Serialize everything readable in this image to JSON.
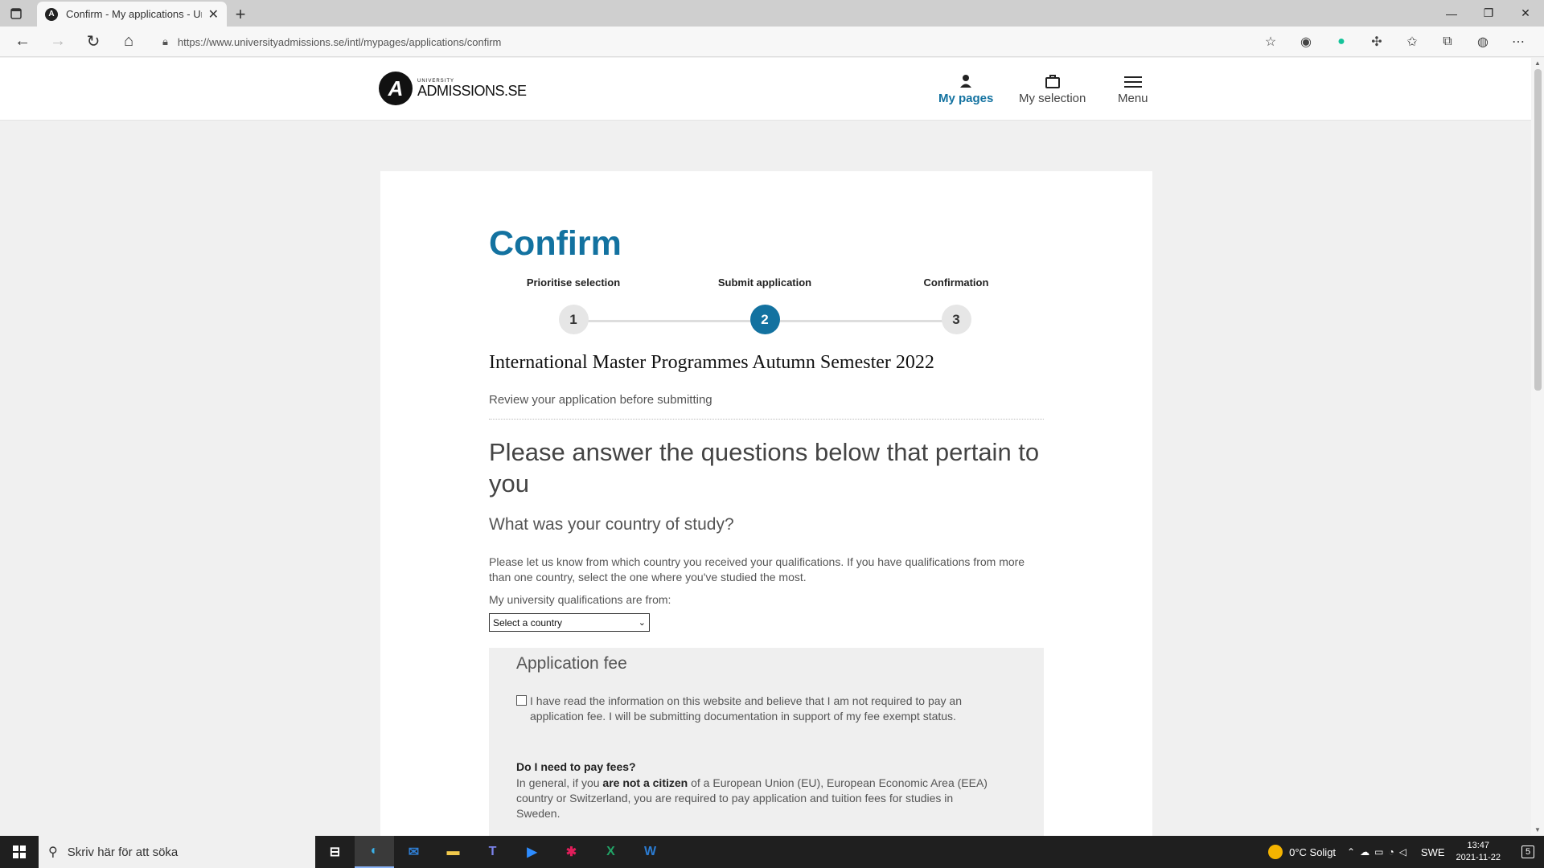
{
  "browser": {
    "tab_title": "Confirm - My applications - Univ",
    "tab_favicon": "A",
    "url": "https://www.universityadmissions.se/intl/mypages/applications/confirm"
  },
  "site": {
    "logo_small": "UNIVERSITY",
    "logo_big": "ADMISSIONS.SE",
    "nav": [
      {
        "label": "My pages",
        "icon": "person-icon"
      },
      {
        "label": "My selection",
        "icon": "bag-icon"
      },
      {
        "label": "Menu",
        "icon": "hamburger-icon"
      }
    ]
  },
  "page": {
    "title": "Confirm",
    "steps": [
      {
        "label": "Prioritise selection",
        "number": "1",
        "state": "done"
      },
      {
        "label": "Submit application",
        "number": "2",
        "state": "current"
      },
      {
        "label": "Confirmation",
        "number": "3",
        "state": "upcoming"
      }
    ],
    "round_title": "International Master Programmes Autumn Semester 2022",
    "review_text": "Review your application before submitting",
    "questions_heading": "Please answer the questions below that pertain to you",
    "country_heading": "What was your country of study?",
    "country_description": "Please let us know from which country you received your qualifications. If you have qualifications from more than one country, select the one where you've studied the most.",
    "country_label": "My university qualifications are from:",
    "country_select_value": "Select a country",
    "fee": {
      "heading": "Application fee",
      "checkbox_label": "I have read the information on this website and believe that I am not required to pay an application fee. I will be submitting documentation in support of my fee exempt status.",
      "checkbox_checked": false,
      "question": "Do I need to pay fees?",
      "answer_before": "In general, if you ",
      "answer_bold": "are not a citizen",
      "answer_after": " of a European Union (EU), European Economic Area (EEA) country or Switzerland, you are required to pay application and tuition fees for studies in Sweden."
    }
  },
  "taskbar": {
    "search_placeholder": "Skriv här för att söka",
    "weather": "0°C  Soligt",
    "language": "SWE",
    "time": "13:47",
    "date": "2021-11-22",
    "notification_count": "5"
  },
  "colors": {
    "accent": "#1372a0",
    "card": "#ffffff",
    "background": "#f0f0f0"
  }
}
